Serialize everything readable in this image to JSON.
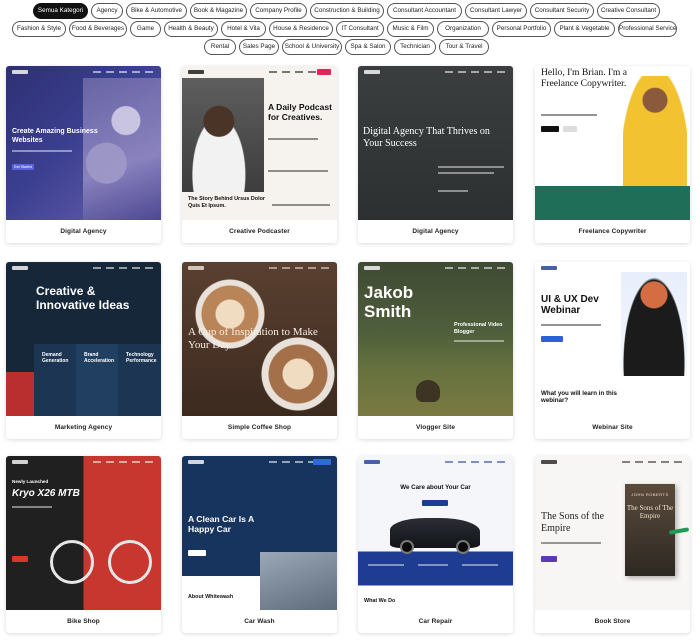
{
  "filters": [
    {
      "label": "Semua Kategori",
      "active": true
    },
    {
      "label": "Agency"
    },
    {
      "label": "Bike & Automotive"
    },
    {
      "label": "Book & Magazine"
    },
    {
      "label": "Company Profile"
    },
    {
      "label": "Construction & Building"
    },
    {
      "label": "Consultant Accountant"
    },
    {
      "label": "Consultant Lawyer"
    },
    {
      "label": "Consultant Security"
    },
    {
      "label": "Creative Consultant"
    },
    {
      "label": "Fashion & Style"
    },
    {
      "label": "Food & Beverages"
    },
    {
      "label": "Game"
    },
    {
      "label": "Health & Beauty"
    },
    {
      "label": "Hotel & Vila"
    },
    {
      "label": "House & Residence"
    },
    {
      "label": "IT Consultant"
    },
    {
      "label": "Music & Film"
    },
    {
      "label": "Organization"
    },
    {
      "label": "Personal Portfolio"
    },
    {
      "label": "Plant & Vegetable"
    },
    {
      "label": "Professional Services"
    },
    {
      "label": "Rental"
    },
    {
      "label": "Sales Page"
    },
    {
      "label": "School & University"
    },
    {
      "label": "Spa & Salon"
    },
    {
      "label": "Technician"
    },
    {
      "label": "Tour & Travel"
    }
  ],
  "templates": [
    {
      "name": "Digital Agency",
      "preview": {
        "headline": "Create Amazing Business Websites",
        "button": "Get Started"
      }
    },
    {
      "name": "Creative Podcaster",
      "preview": {
        "headline": "A Daily Podcast for Creatives.",
        "subheadline": "The Story Behind Ursus Dolor Quis Et Ipsum."
      }
    },
    {
      "name": "Digital Agency",
      "preview": {
        "headline": "Digital Agency That Thrives on Your Success"
      }
    },
    {
      "name": "Freelance Copywriter",
      "preview": {
        "headline": "Hello, I'm Brian. I'm a Freelance Copywriter."
      }
    },
    {
      "name": "Marketing Agency",
      "preview": {
        "headline": "Creative & Innovative Ideas",
        "columns": [
          "Demand Generation",
          "Brand Acceleration",
          "Technology Performance"
        ]
      }
    },
    {
      "name": "Simple Coffee Shop",
      "preview": {
        "headline": "A Cup of Inspiration to Make Your Day"
      }
    },
    {
      "name": "Vlogger Site",
      "preview": {
        "headline": "Jakob Smith",
        "subheadline": "Professional Video Blogger"
      }
    },
    {
      "name": "Webinar Site",
      "preview": {
        "headline": "UI & UX Dev Webinar",
        "subheadline": "What you will learn in this webinar?"
      }
    },
    {
      "name": "Bike Shop",
      "preview": {
        "eyebrow": "Newly Launched",
        "headline": "Kryo X26 MTB"
      }
    },
    {
      "name": "Car Wash",
      "preview": {
        "headline": "A Clean Car Is A Happy Car",
        "subheadline": "About Whitewash"
      }
    },
    {
      "name": "Car Repair",
      "preview": {
        "headline": "We Care about Your Car",
        "subheadline": "What We Do"
      }
    },
    {
      "name": "Book Store",
      "preview": {
        "headline": "The Sons of the Empire",
        "cover_author": "JOHN ROBERTS",
        "cover_title": "The Sons of The Empire"
      }
    }
  ],
  "colors": {
    "chip_border": "#555555",
    "chip_active_bg": "#111111",
    "card_shadow": "rgba(0,0,0,0.14)"
  }
}
